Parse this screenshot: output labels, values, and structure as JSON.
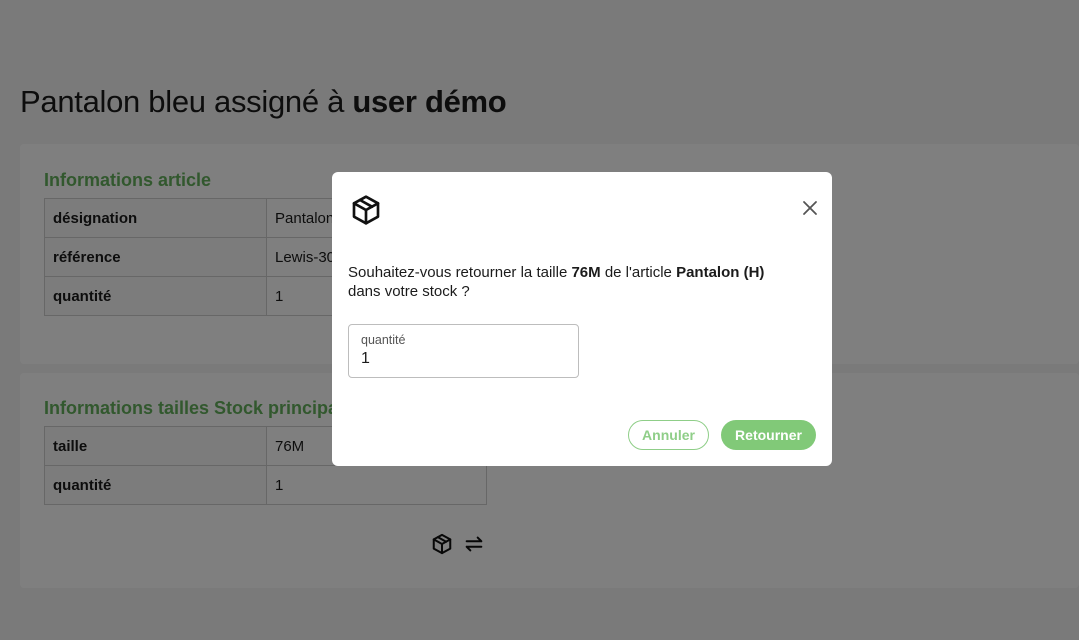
{
  "page": {
    "title_prefix": "Pantalon bleu assigné à",
    "title_user": "user démo"
  },
  "article_card": {
    "heading": "Informations article",
    "rows": [
      {
        "key": "désignation",
        "value": "Pantalon"
      },
      {
        "key": "référence",
        "value": "Lewis-30"
      },
      {
        "key": "quantité",
        "value": "1"
      }
    ]
  },
  "sizes_card": {
    "heading": "Informations tailles Stock principal",
    "rows": [
      {
        "key": "taille",
        "value": "76M"
      },
      {
        "key": "quantité",
        "value": "1"
      }
    ],
    "actions": [
      {
        "icon": "box-icon"
      },
      {
        "icon": "swap-arrows-icon"
      }
    ]
  },
  "modal": {
    "icon": "box-icon",
    "message_part1": "Souhaitez-vous retourner la taille",
    "message_size": "76M",
    "message_part2": "de l'article",
    "message_article": "Pantalon (H)",
    "message_part3": "dans votre stock ?",
    "quantity_label": "quantité",
    "quantity_value": "1",
    "cancel_label": "Annuler",
    "confirm_label": "Retourner"
  },
  "colors": {
    "accent_green": "#64b15c",
    "button_green": "#81c978",
    "overlay": "rgba(0,0,0,0.5)"
  }
}
